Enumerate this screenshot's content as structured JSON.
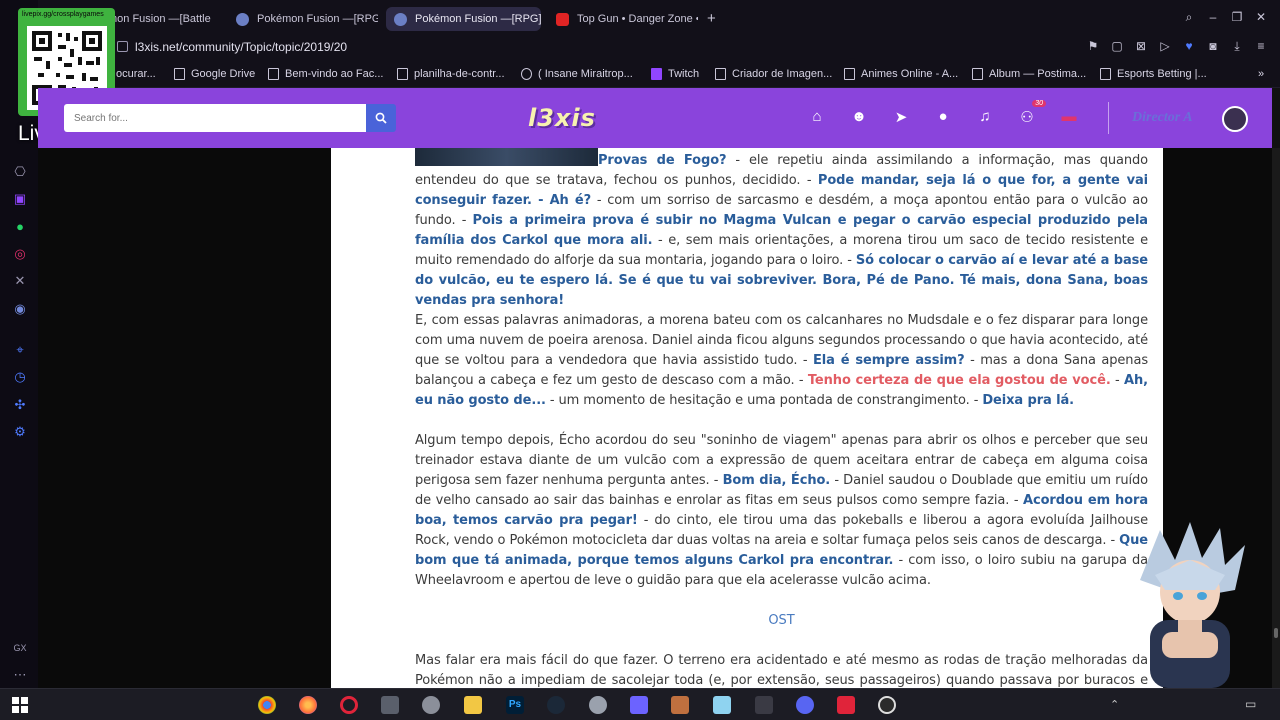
{
  "browser": {
    "tabs": [
      {
        "title": "mon Fusion —[Battle",
        "active": false
      },
      {
        "title": "Pokémon Fusion —[RPG]",
        "active": false
      },
      {
        "title": "Pokémon Fusion —[RPG]",
        "active": true
      },
      {
        "title": "Top Gun • Danger Zone •",
        "active": false
      }
    ],
    "url": "l3xis.net/community/Topic/topic/2019/20",
    "bookmarks": [
      "ocurar...",
      "Google Drive",
      "Bem-vindo ao Fac...",
      "planilha-de-contr...",
      "( Insane Miraitrop...",
      "Twitch",
      "Criador de Imagen...",
      "Animes Online - A...",
      "Album — Postima...",
      "Esports Betting |..."
    ]
  },
  "overlay": {
    "qr_title": "livepix.gg/crossplaygames",
    "livepix": "LivePix!!"
  },
  "header": {
    "search_placeholder": "Search for...",
    "logo": "l3xis",
    "notification_badge": "30",
    "username": "Director A",
    "accent": "#8a44dc"
  },
  "article": {
    "paragraphs": [
      [
        {
          "t": "Provas de Fogo?",
          "s": "b"
        },
        {
          "t": " - ele repetiu ainda assimilando a informação, mas quando entendeu do que se tratava, fechou os punhos, decidido. - "
        },
        {
          "t": "Pode mandar, seja lá o que for, a gente vai conseguir fazer. - Ah é?",
          "s": "b"
        },
        {
          "t": " - com um sorriso de sarcasmo e desdém, a moça apontou então para o vulcão ao fundo. - "
        },
        {
          "t": "Pois a primeira prova é subir no Magma Vulcan e pegar o carvão especial produzido pela família dos Carkol que mora ali.",
          "s": "b"
        },
        {
          "t": " - e, sem mais orientações, a morena tirou um saco de tecido resistente e muito remendado do alforje da sua montaria, jogando para o loiro. - "
        },
        {
          "t": "Só colocar o carvão aí e levar até a base do vulcão, eu te espero lá. Se é que tu vai sobreviver. Bora, Pé de Pano. Té mais, dona Sana, boas vendas pra senhora!",
          "s": "b"
        }
      ],
      [
        {
          "t": "E, com essas palavras animadoras, a morena bateu com os calcanhares no Mudsdale e o fez disparar para longe com uma nuvem de poeira arenosa. Daniel ainda ficou alguns segundos processando o que havia acontecido, até que se voltou para a vendedora que havia assistido tudo. - "
        },
        {
          "t": "Ela é sempre assim?",
          "s": "b"
        },
        {
          "t": " - mas a dona Sana apenas balançou a cabeça e fez um gesto de descaso com a mão. - "
        },
        {
          "t": "Tenho certeza de que ela gostou de você.",
          "s": "r"
        },
        {
          "t": " - "
        },
        {
          "t": "Ah, eu não gosto de...",
          "s": "b"
        },
        {
          "t": " - um momento de hesitação e uma pontada de constrangimento. - "
        },
        {
          "t": "Deixa pra lá.",
          "s": "b"
        }
      ],
      [
        {
          "t": "Algum tempo depois, Écho acordou do seu \"soninho de viagem\" apenas para abrir os olhos e perceber que seu treinador estava diante de um vulcão com a expressão de quem aceitara entrar de cabeça em alguma coisa perigosa sem fazer nenhuma pergunta antes. - "
        },
        {
          "t": "Bom dia, Écho.",
          "s": "b"
        },
        {
          "t": " - Daniel saudou o Doublade que emitiu um ruído de velho cansado ao sair das bainhas e enrolar as fitas em seus pulsos como sempre fazia. - "
        },
        {
          "t": "Acordou em hora boa, temos carvão pra pegar!",
          "s": "b"
        },
        {
          "t": " - do cinto, ele tirou uma das pokeballs e liberou a agora evoluída Jailhouse Rock, vendo o Pokémon motocicleta dar duas voltas na areia e soltar fumaça pelos seis canos de descarga. - "
        },
        {
          "t": "Que bom que tá animada, porque temos alguns Carkol pra encontrar.",
          "s": "b"
        },
        {
          "t": " - com isso, o loiro subiu na garupa da Wheelavroom e apertou de leve o guidão para que ela acelerasse vulcão acima."
        }
      ],
      [
        {
          "t": "Mas falar era mais fácil do que fazer. O terreno era acidentado e até mesmo as rodas de tração melhoradas da Pokémon não a impediam de sacolejar toda (e, por extensão, seus passageiros) quando passava por buracos e relevos altos, sem falar nos vários pontos onde o caminho desabava e os obrigava a tomar outro rumo. Com o calor insuportável"
        }
      ]
    ],
    "ost_label": "OST"
  }
}
